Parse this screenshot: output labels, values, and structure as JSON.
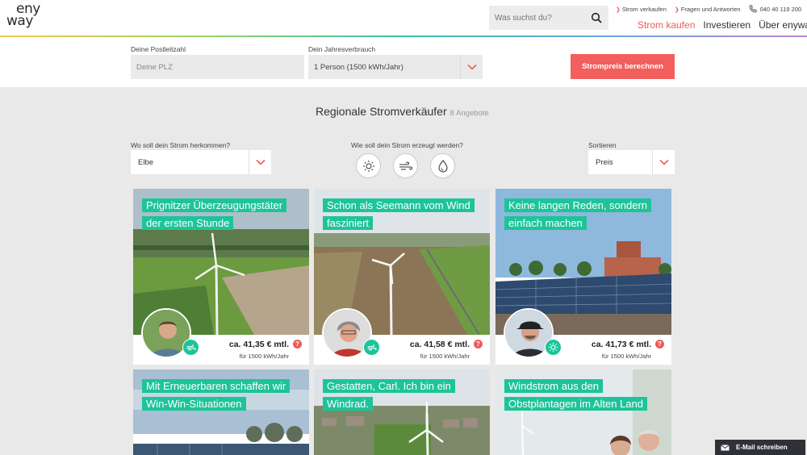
{
  "header": {
    "logo_line1": "eny",
    "logo_line2": "way",
    "search_placeholder": "Was suchst du?",
    "top_links": [
      "Strom verkaufen",
      "Fragen und Antworten"
    ],
    "phone": "040 40 119 200",
    "nav": [
      "Strom kaufen",
      "Investieren",
      "Über enyway"
    ]
  },
  "calculator": {
    "zip_label": "Deine Postleitzahl",
    "zip_placeholder": "Deine PLZ",
    "consumption_label": "Dein Jahresverbrauch",
    "consumption_value": "1 Person (1500 kWh/Jahr)",
    "submit_label": "Strompreis berechnen"
  },
  "section": {
    "title": "Regionale Stromverkäufer",
    "count": "8 Angebote"
  },
  "filters": {
    "origin_label": "Wo soll dein Strom herkommen?",
    "origin_value": "Elbe",
    "type_label": "Wie soll dein Strom erzeugt werden?",
    "sort_label": "Sortieren",
    "sort_value": "Preis"
  },
  "cards": [
    {
      "headline": "Prignitzer Überzeugungstäter der ersten Stunde",
      "price": "ca. 41,35 € mtl.",
      "per": "für 1500 kWh/Jahr",
      "type_icon": "wind-icon"
    },
    {
      "headline": "Schon als Seemann vom Wind fasziniert",
      "price": "ca. 41,58 € mtl.",
      "per": "für 1500 kWh/Jahr",
      "type_icon": "wind-icon"
    },
    {
      "headline": "Keine langen Reden, sondern einfach machen",
      "price": "ca. 41,73 € mtl.",
      "per": "für 1500 kWh/Jahr",
      "type_icon": "sun-icon"
    },
    {
      "headline": "Mit Erneuerbaren schaffen wir Win-Win-Situationen"
    },
    {
      "headline": "Gestatten, Carl. Ich bin ein Windrad."
    },
    {
      "headline": "Windstrom aus den Obstplantagen im Alten Land"
    }
  ],
  "email_tab": "E-Mail schreiben",
  "colors": {
    "accent_red": "#f25f5c",
    "badge_green": "#1ec499"
  }
}
